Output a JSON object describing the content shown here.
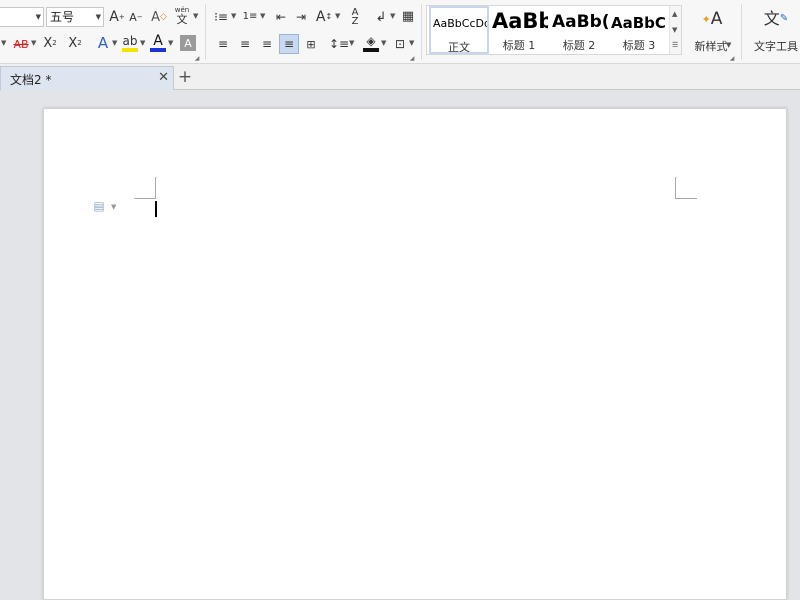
{
  "font": {
    "size_value": "五号"
  },
  "styles": [
    {
      "sample": "AaBbCcDd",
      "name": "正文"
    },
    {
      "sample": "AaBb",
      "name": "标题 1"
    },
    {
      "sample": "AaBb(",
      "name": "标题 2"
    },
    {
      "sample": "AaBbC",
      "name": "标题 3"
    }
  ],
  "buttons": {
    "new_style_label": "新样式",
    "text_tools_label": "文字工具"
  },
  "tabs": [
    {
      "label": "文档2 *"
    }
  ],
  "colors": {
    "accent_blue": "#2f63c4",
    "highlight_yellow": "#f5e400",
    "font_red": "#d82020"
  }
}
